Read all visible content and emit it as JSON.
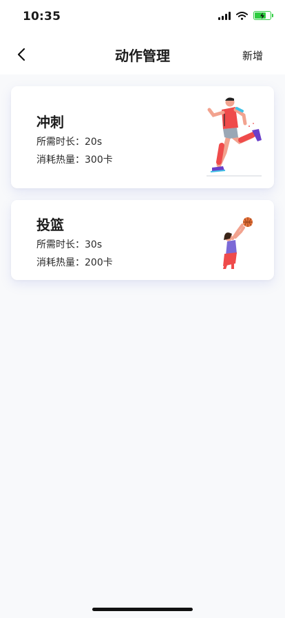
{
  "status_bar": {
    "time": "10:35",
    "battery_level": 0.8
  },
  "nav": {
    "title": "动作管理",
    "action_label": "新增",
    "back_icon": "chevron-left-icon"
  },
  "actions": [
    {
      "name": "冲刺",
      "duration_text": "所需时长：20s",
      "calories_text": "消耗热量：300卡",
      "illustration": "sprinter-illustration"
    },
    {
      "name": "投篮",
      "duration_text": "所需时长：30s",
      "calories_text": "消耗热量：200卡",
      "illustration": "basketball-shooter-illustration"
    }
  ],
  "colors": {
    "accent_red": "#ef4b4b",
    "shoe_purple": "#6a3fc9",
    "battery_green": "#2ecc40",
    "background": "#f8f9fb"
  }
}
